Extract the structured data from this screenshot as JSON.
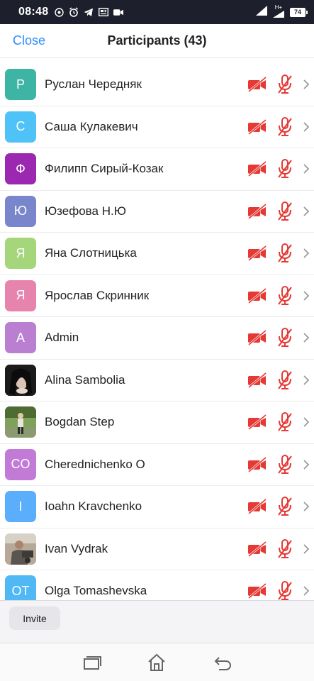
{
  "statusbar": {
    "time": "08:48",
    "battery": "74",
    "network": "H+",
    "icons": [
      "location-icon",
      "alarm-icon",
      "telegram-icon",
      "news-icon",
      "video-icon"
    ]
  },
  "header": {
    "close_label": "Close",
    "title": "Participants (43)"
  },
  "participants": [
    {
      "initial": "Р",
      "name": "Руслан Чередняк",
      "color": "#3eb5a4",
      "photo": false
    },
    {
      "initial": "С",
      "name": "Саша Кулакевич",
      "color": "#4fc3f7",
      "photo": false
    },
    {
      "initial": "Ф",
      "name": "Филипп Сирый-Козак",
      "color": "#9c27b0",
      "photo": false
    },
    {
      "initial": "Ю",
      "name": "Юзефова Н.Ю",
      "color": "#7986cb",
      "photo": false
    },
    {
      "initial": "Я",
      "name": "Яна Слотницька",
      "color": "#a5d67c",
      "photo": false
    },
    {
      "initial": "Я",
      "name": "Ярослав Скринник",
      "color": "#e784ad",
      "photo": false
    },
    {
      "initial": "A",
      "name": "Admin",
      "color": "#ba7fd1",
      "photo": false
    },
    {
      "initial": "",
      "name": "Alina Sambolia",
      "color": "#1a1a1a",
      "photo": true
    },
    {
      "initial": "",
      "name": "Bogdan Step",
      "color": "#6d8b4a",
      "photo": true
    },
    {
      "initial": "CO",
      "name": "Cherednichenko O",
      "color": "#c17ad6",
      "photo": false
    },
    {
      "initial": "I",
      "name": "Ioahn Kravchenko",
      "color": "#5aaefc",
      "photo": false
    },
    {
      "initial": "",
      "name": "Ivan Vydrak",
      "color": "#8a7a68",
      "photo": true
    },
    {
      "initial": "OT",
      "name": "Olga Tomashevska",
      "color": "#4fb8f5",
      "photo": false
    }
  ],
  "status_icons": {
    "video": "video-off-icon",
    "mic": "mic-muted-icon",
    "muted_color": "#e53935"
  },
  "footer": {
    "invite_label": "Invite"
  },
  "navbar": {
    "icons": [
      "recent-apps-icon",
      "home-icon",
      "back-icon"
    ]
  }
}
